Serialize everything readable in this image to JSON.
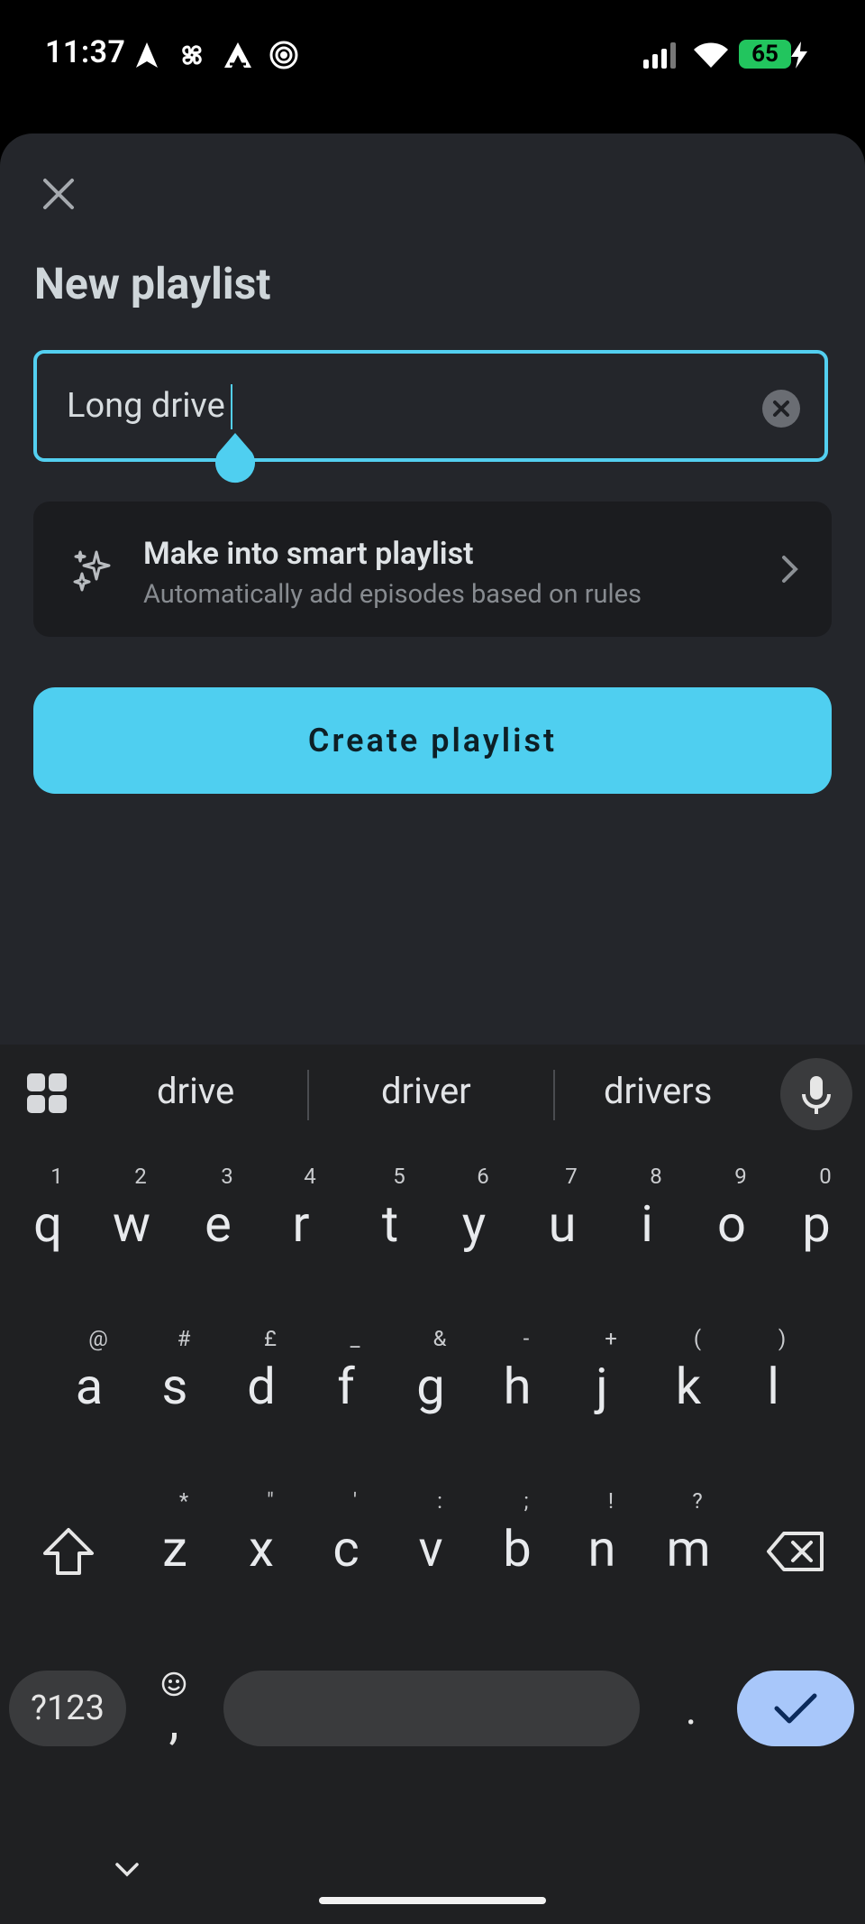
{
  "status_bar": {
    "time": "11:37",
    "battery": "65"
  },
  "sheet": {
    "title": "New playlist",
    "name_input": {
      "value": "Long drive"
    },
    "smart_playlist": {
      "title": "Make into smart playlist",
      "subtitle": "Automatically add episodes based on rules"
    },
    "create_button": "Create playlist"
  },
  "keyboard": {
    "suggestions": [
      "drive",
      "driver",
      "drivers"
    ],
    "row1": [
      {
        "k": "q",
        "h": "1"
      },
      {
        "k": "w",
        "h": "2"
      },
      {
        "k": "e",
        "h": "3"
      },
      {
        "k": "r",
        "h": "4"
      },
      {
        "k": "t",
        "h": "5"
      },
      {
        "k": "y",
        "h": "6"
      },
      {
        "k": "u",
        "h": "7"
      },
      {
        "k": "i",
        "h": "8"
      },
      {
        "k": "o",
        "h": "9"
      },
      {
        "k": "p",
        "h": "0"
      }
    ],
    "row2": [
      {
        "k": "a",
        "h": "@"
      },
      {
        "k": "s",
        "h": "#"
      },
      {
        "k": "d",
        "h": "£"
      },
      {
        "k": "f",
        "h": "_"
      },
      {
        "k": "g",
        "h": "&"
      },
      {
        "k": "h",
        "h": "-"
      },
      {
        "k": "j",
        "h": "+"
      },
      {
        "k": "k",
        "h": "("
      },
      {
        "k": "l",
        "h": ")"
      }
    ],
    "row3": [
      {
        "k": "z",
        "h": "*"
      },
      {
        "k": "x",
        "h": "\""
      },
      {
        "k": "c",
        "h": "'"
      },
      {
        "k": "v",
        "h": ":"
      },
      {
        "k": "b",
        "h": ";"
      },
      {
        "k": "n",
        "h": "!"
      },
      {
        "k": "m",
        "h": "?"
      }
    ],
    "symbols_key": "?123",
    "comma_key": ",",
    "period_key": "."
  },
  "colors": {
    "accent": "#4fcff0",
    "enter_key": "#a8c7fa",
    "sheet_bg": "#24262b",
    "keyboard_bg": "#1f2022"
  }
}
